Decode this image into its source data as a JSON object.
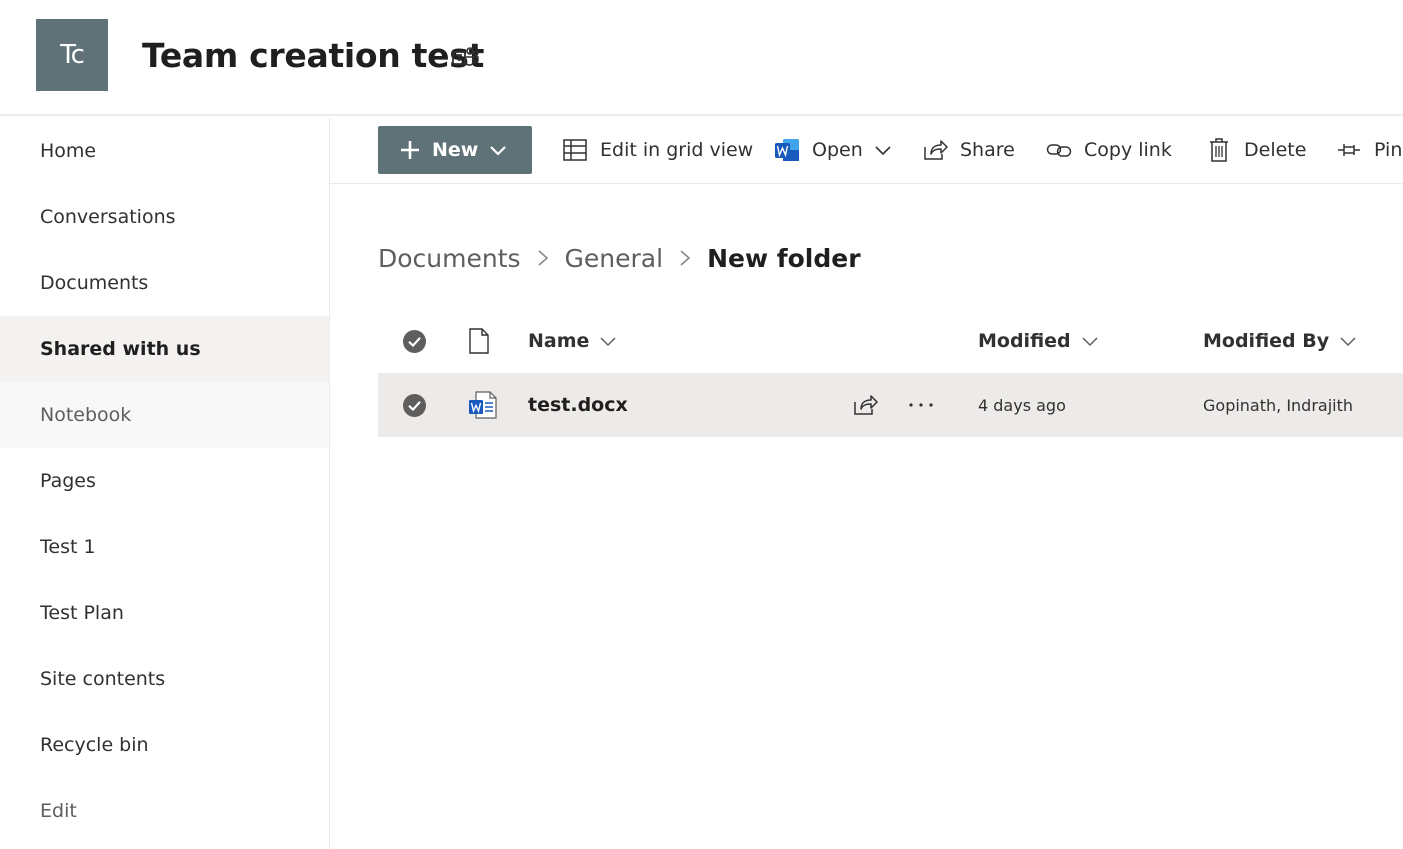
{
  "site": {
    "logo_initials": "Tc",
    "title": "Team creation test",
    "teams_icon": "teams-icon"
  },
  "nav": {
    "items": [
      {
        "label": "Home"
      },
      {
        "label": "Conversations"
      },
      {
        "label": "Documents"
      },
      {
        "label": "Shared with us",
        "state": "selected"
      },
      {
        "label": "Notebook",
        "state": "hover"
      },
      {
        "label": "Pages"
      },
      {
        "label": "Test 1"
      },
      {
        "label": "Test Plan"
      },
      {
        "label": "Site contents"
      },
      {
        "label": "Recycle bin"
      },
      {
        "label": "Edit"
      }
    ]
  },
  "commands": {
    "new_label": "New",
    "edit_grid_label": "Edit in grid view",
    "open_label": "Open",
    "share_label": "Share",
    "copy_link_label": "Copy link",
    "delete_label": "Delete",
    "pin_label": "Pin"
  },
  "breadcrumb": {
    "items": [
      "Documents",
      "General"
    ],
    "current": "New folder"
  },
  "list": {
    "columns": {
      "name": "Name",
      "modified": "Modified",
      "modified_by": "Modified By"
    },
    "rows": [
      {
        "name": "test.docx",
        "modified": "4 days ago",
        "modified_by": "Gopinath, Indrajith",
        "selected": true
      }
    ]
  },
  "colors": {
    "theme_primary": "#5f7278",
    "word_blue": "#185abd",
    "selected_row": "#edebe9"
  }
}
